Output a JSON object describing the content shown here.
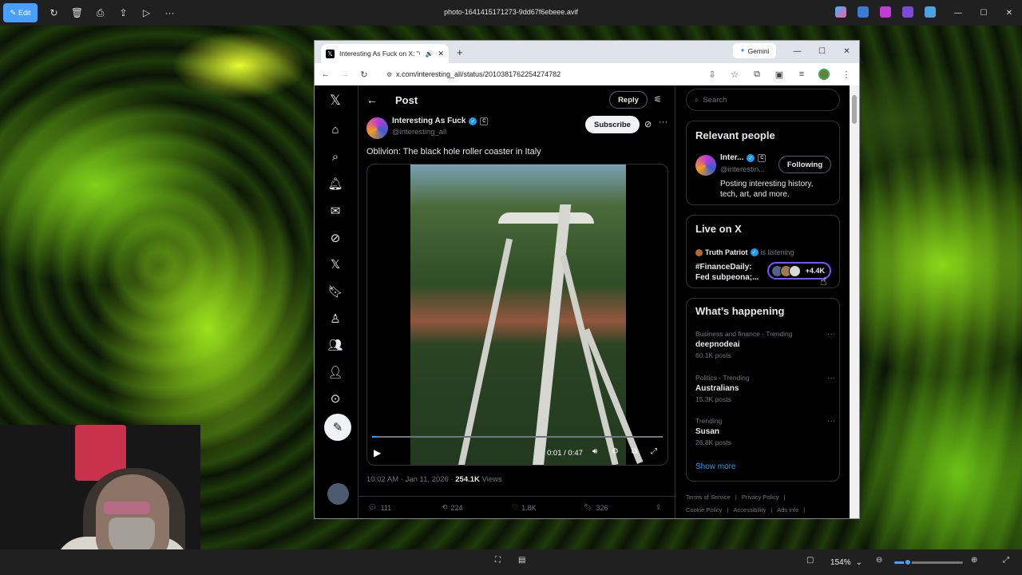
{
  "viewer": {
    "edit_label": "Edit",
    "file_name": "photo-1641415171273-9dd67f6ebeee.avif",
    "zoom_level": "154%",
    "zoom_fraction": 0.2
  },
  "browser": {
    "tab_title": "Interesting As Fuck on X: \"O",
    "gemini_label": "Gemini",
    "url": "x.com/interesting_all/status/2010381762254274782"
  },
  "post": {
    "header": "Post",
    "reply_label": "Reply",
    "author_name": "Interesting As Fuck",
    "author_handle": "@interesting_all",
    "subscribe_label": "Subscribe",
    "text": "Oblivion: The black hole roller coaster in Italy",
    "video_time": "0:01 / 0:47",
    "video_progress": 0.02,
    "timestamp": "10:02 AM · Jan 11, 2026 · ",
    "views_count": "254.1K",
    "views_label": " Views",
    "replies": "111",
    "reposts": "224",
    "likes": "1.8K",
    "bookmarks": "326"
  },
  "sidebar": {
    "search_placeholder": "Search",
    "relevant_title": "Relevant people",
    "rp_name": "Inter...",
    "rp_handle": "@interestin...",
    "following_label": "Following",
    "rp_bio": "Posting interesting history, tech, art, and more.",
    "live_title": "Live on X",
    "live_host": "Truth Patriot",
    "live_status": "is listening",
    "live_space": "#FinanceDaily: Fed subpeona;...",
    "live_count": "+4.4K",
    "happening_title": "What’s happening",
    "trends": [
      {
        "category": "Business and finance · Trending",
        "name": "deepnodeai",
        "count": "60.1K posts"
      },
      {
        "category": "Politics · Trending",
        "name": "Australians",
        "count": "15.3K posts"
      },
      {
        "category": "Trending",
        "name": "Susan",
        "count": "26.8K posts"
      }
    ],
    "show_more": "Show more",
    "footer": [
      "Terms of Service",
      "|",
      "Privacy Policy",
      "|",
      "Cookie Policy",
      "|",
      "Accessibility",
      "|",
      "Ads info",
      "|"
    ]
  },
  "colors": {
    "accent": "#1d9bf0",
    "edit_button": "#4a9eff",
    "live_ring": "#7856ff"
  }
}
